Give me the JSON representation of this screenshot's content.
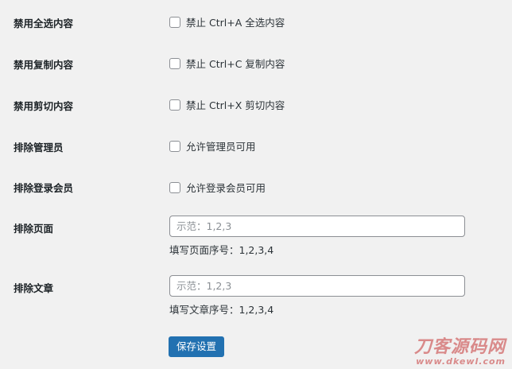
{
  "settings": {
    "disable_select_all": {
      "label": "禁用全选内容",
      "checkbox_text": "禁止 Ctrl+A 全选内容",
      "checked": false
    },
    "disable_copy": {
      "label": "禁用复制内容",
      "checkbox_text": "禁止 Ctrl+C 复制内容",
      "checked": false
    },
    "disable_cut": {
      "label": "禁用剪切内容",
      "checkbox_text": "禁止 Ctrl+X 剪切内容",
      "checked": false
    },
    "exclude_admin": {
      "label": "排除管理员",
      "checkbox_text": "允许管理员可用",
      "checked": false
    },
    "exclude_members": {
      "label": "排除登录会员",
      "checkbox_text": "允许登录会员可用",
      "checked": false
    },
    "exclude_pages": {
      "label": "排除页面",
      "value": "",
      "placeholder": "示范：1,2,3",
      "description": "填写页面序号：1,2,3,4"
    },
    "exclude_posts": {
      "label": "排除文章",
      "value": "",
      "placeholder": "示范：1,2,3",
      "description": "填写文章序号：1,2,3,4"
    }
  },
  "save_button": {
    "label": "保存设置"
  },
  "watermark": {
    "title": "刀客源码网",
    "url": "www.dkewl.com"
  },
  "colors": {
    "background": "#f1f1f1",
    "primary_button": "#2271b1",
    "label_text": "#1d2327",
    "input_border": "#8c8f94",
    "watermark": "#d98a8a"
  }
}
